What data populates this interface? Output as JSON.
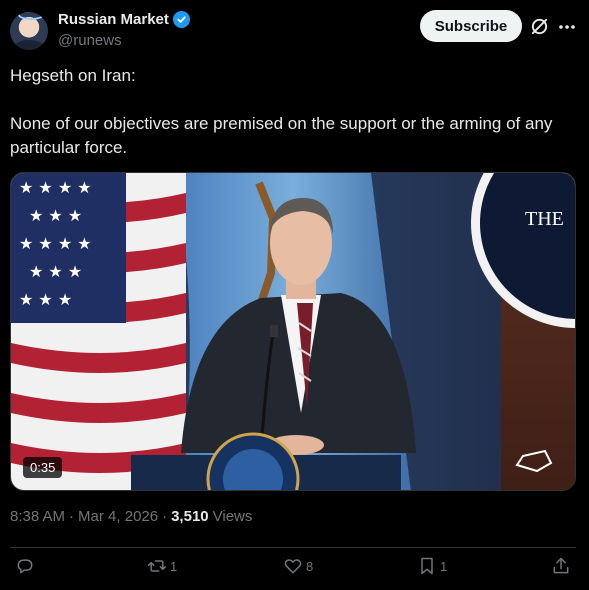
{
  "author": {
    "display_name": "Russian Market",
    "handle": "@runews",
    "verified": true
  },
  "header": {
    "subscribe_label": "Subscribe",
    "icons": [
      "grok-icon",
      "more-icon"
    ]
  },
  "tweet": {
    "line1": "Hegseth on Iran:",
    "line2": "None of our objectives are premised on the support or the arming of any particular force."
  },
  "media": {
    "duration": "0:35",
    "seal_text": "THE",
    "podium_seal": "DEPARTMENT OF WAR"
  },
  "meta": {
    "time": "8:38 AM",
    "sep1": "·",
    "date": "Mar 4, 2026",
    "sep2": "·",
    "views_count": "3,510",
    "views_label": "Views"
  },
  "actions": {
    "reply_count": "",
    "retweet_count": "1",
    "like_count": "8",
    "bookmark_count": "1"
  },
  "colors": {
    "accent": "#1d9bf0",
    "muted": "#71767b",
    "text": "#e7e9ea",
    "background": "#000000"
  }
}
